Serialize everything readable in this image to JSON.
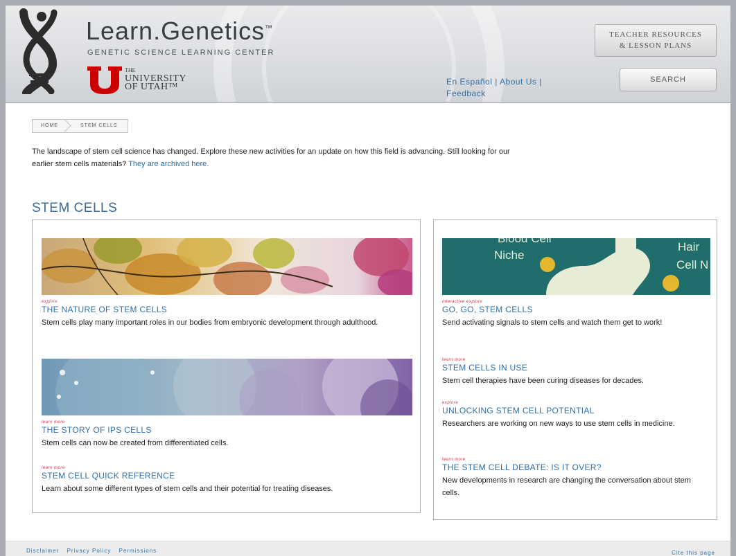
{
  "header": {
    "brand_name": "Learn.Genetics",
    "brand_tm": "™",
    "brand_subtitle": "GENETIC SCIENCE LEARNING CENTER",
    "university_the": "THE",
    "university_line1": "UNIVERSITY",
    "university_line2": "OF UTAH™",
    "links": [
      "En Español",
      "About Us",
      "Feedback"
    ],
    "link_separator": "|",
    "teacher_button_line1": "TEACHER RESOURCES",
    "teacher_button_line2": "& LESSON PLANS",
    "search_button": "SEARCH",
    "colors": {
      "brand_red": "#cc0000",
      "link_blue": "#3272a6"
    }
  },
  "breadcrumb": [
    "HOME",
    "STEM CELLS"
  ],
  "intro": {
    "text": "The landscape of stem cell science has changed. Explore these new activities for an update on how this field is advancing. Still looking for our earlier stem cells materials?",
    "link": "They are archived here."
  },
  "section_title": "STEM CELLS",
  "left_panel": {
    "items": [
      {
        "tag": "explore",
        "title": "THE NATURE OF STEM CELLS",
        "description": "Stem cells play many important roles in our bodies from embryonic development through adulthood.",
        "image": "leaves-banner"
      },
      {
        "tag": "learn more",
        "title": "THE STORY OF IPS CELLS",
        "description": "Stem cells can now be created from differentiated cells.",
        "image": "cells-banner"
      },
      {
        "tag": "learn more",
        "title": "STEM CELL QUICK REFERENCE",
        "description": "Learn about some different types of stem cells and their potential for treating diseases."
      }
    ]
  },
  "right_panel": {
    "banner_labels": [
      "Blood Cell",
      "Niche",
      "Hair",
      "Cell N"
    ],
    "items": [
      {
        "tag": "interactive explore",
        "title": "GO, GO, STEM CELLS",
        "description": "Send activating signals to stem cells and watch them get to work!",
        "image": "niche-banner"
      },
      {
        "tag": "learn more",
        "title": "STEM CELLS IN USE",
        "description": "Stem cell therapies have been curing diseases for decades."
      },
      {
        "tag": "explore",
        "title": "UNLOCKING STEM CELL POTENTIAL",
        "description": "Researchers are working on new ways to use stem cells in medicine."
      },
      {
        "tag": "learn more",
        "title": "THE STEM CELL DEBATE: IS IT OVER?",
        "description": "New developments in research are changing the conversation about stem cells."
      }
    ]
  },
  "footer": {
    "links": [
      "Disclaimer",
      "Privacy Policy",
      "Permissions"
    ],
    "cite": "Cite this page"
  }
}
